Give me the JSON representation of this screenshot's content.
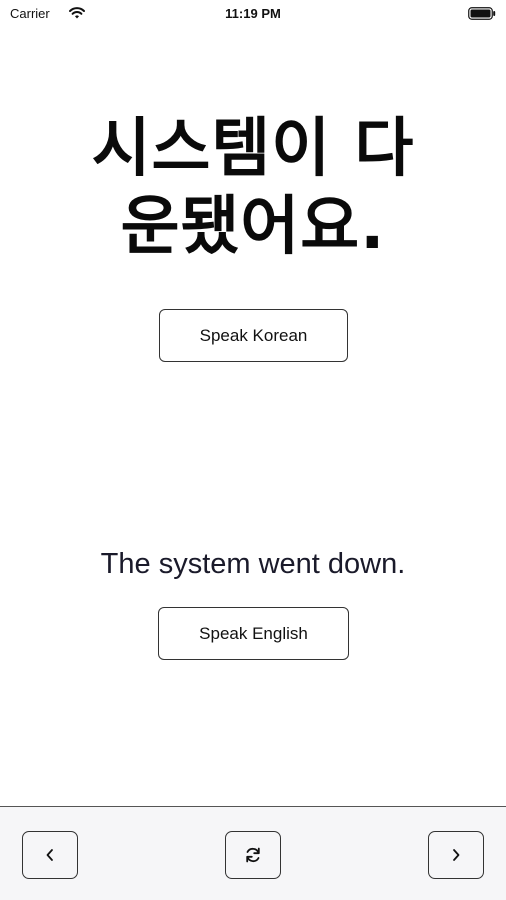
{
  "status_bar": {
    "carrier": "Carrier",
    "time": "11:19 PM"
  },
  "main": {
    "korean_line1": "시스템이 다",
    "korean_line2": "운됐어요.",
    "speak_korean_label": "Speak Korean",
    "english_text": "The system went down.",
    "speak_english_label": "Speak English"
  },
  "toolbar": {
    "prev_icon": "chevron-left-icon",
    "refresh_icon": "refresh-icon",
    "next_icon": "chevron-right-icon"
  }
}
